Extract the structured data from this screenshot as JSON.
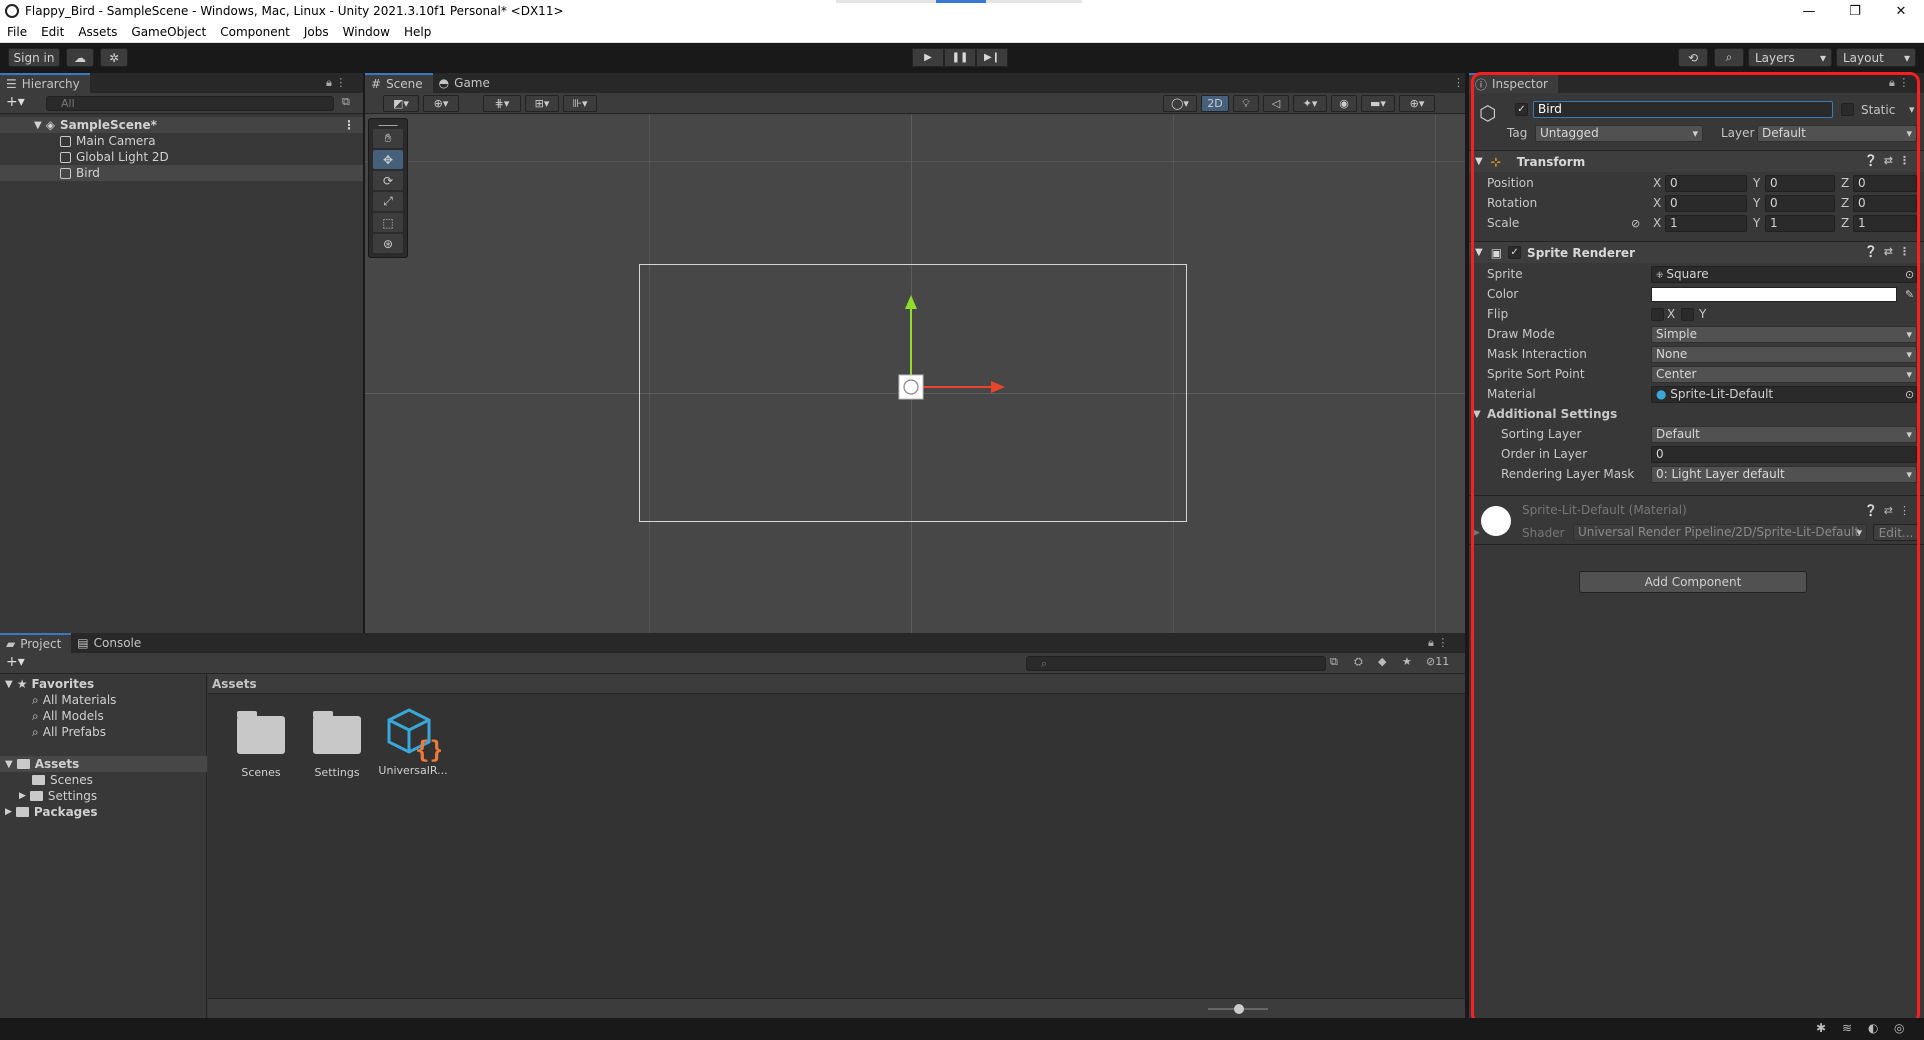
{
  "window": {
    "title": "Flappy_Bird - SampleScene - Windows, Mac, Linux - Unity 2021.3.10f1 Personal* <DX11>",
    "controls": [
      "—",
      "❐",
      "✕"
    ]
  },
  "menu": [
    "File",
    "Edit",
    "Assets",
    "GameObject",
    "Component",
    "Jobs",
    "Window",
    "Help"
  ],
  "toolbar": {
    "sign_in": "Sign in",
    "layers": "Layers",
    "layout": "Layout"
  },
  "hierarchy": {
    "tab": "Hierarchy",
    "search_placeholder": "All",
    "scene": "SampleScene*",
    "items": [
      "Main Camera",
      "Global Light 2D",
      "Bird"
    ]
  },
  "scene": {
    "tabs": [
      "Scene",
      "Game"
    ],
    "mode_2d": "2D"
  },
  "inspector": {
    "tab": "Inspector",
    "object_name": "Bird",
    "static_label": "Static",
    "tag_label": "Tag",
    "tag_value": "Untagged",
    "layer_label": "Layer",
    "layer_value": "Default",
    "transform": {
      "title": "Transform",
      "rows": [
        {
          "label": "Position",
          "x": "0",
          "y": "0",
          "z": "0"
        },
        {
          "label": "Rotation",
          "x": "0",
          "y": "0",
          "z": "0"
        },
        {
          "label": "Scale",
          "x": "1",
          "y": "1",
          "z": "1"
        }
      ],
      "axis_x": "X",
      "axis_y": "Y",
      "axis_z": "Z"
    },
    "sprite_renderer": {
      "title": "Sprite Renderer",
      "sprite_label": "Sprite",
      "sprite_value": "Square",
      "color_label": "Color",
      "flip_label": "Flip",
      "flip_x": "X",
      "flip_y": "Y",
      "draw_mode_label": "Draw Mode",
      "draw_mode_value": "Simple",
      "mask_label": "Mask Interaction",
      "mask_value": "None",
      "sort_point_label": "Sprite Sort Point",
      "sort_point_value": "Center",
      "material_label": "Material",
      "material_value": "Sprite-Lit-Default",
      "additional": "Additional Settings",
      "sorting_layer_label": "Sorting Layer",
      "sorting_layer_value": "Default",
      "order_label": "Order in Layer",
      "order_value": "0",
      "render_mask_label": "Rendering Layer Mask",
      "render_mask_value": "0: Light Layer default"
    },
    "material": {
      "title": "Sprite-Lit-Default (Material)",
      "shader_label": "Shader",
      "shader_value": "Universal Render Pipeline/2D/Sprite-Lit-Default",
      "edit": "Edit..."
    },
    "add_component": "Add Component"
  },
  "project": {
    "tabs": [
      "Project",
      "Console"
    ],
    "hidden_count": "11",
    "favorites": "Favorites",
    "fav_items": [
      "All Materials",
      "All Models",
      "All Prefabs"
    ],
    "assets": "Assets",
    "asset_folders": [
      "Scenes",
      "Settings"
    ],
    "packages": "Packages",
    "breadcrumb": "Assets",
    "grid_items": [
      "Scenes",
      "Settings",
      "UniversalR..."
    ]
  },
  "colors": {
    "accent_outline": "#ff1e1e",
    "gizmo_up": "#8fdc2c",
    "gizmo_right": "#e8452c",
    "package_icon": "#3aa7d8",
    "package_braces": "#f07a3a"
  }
}
